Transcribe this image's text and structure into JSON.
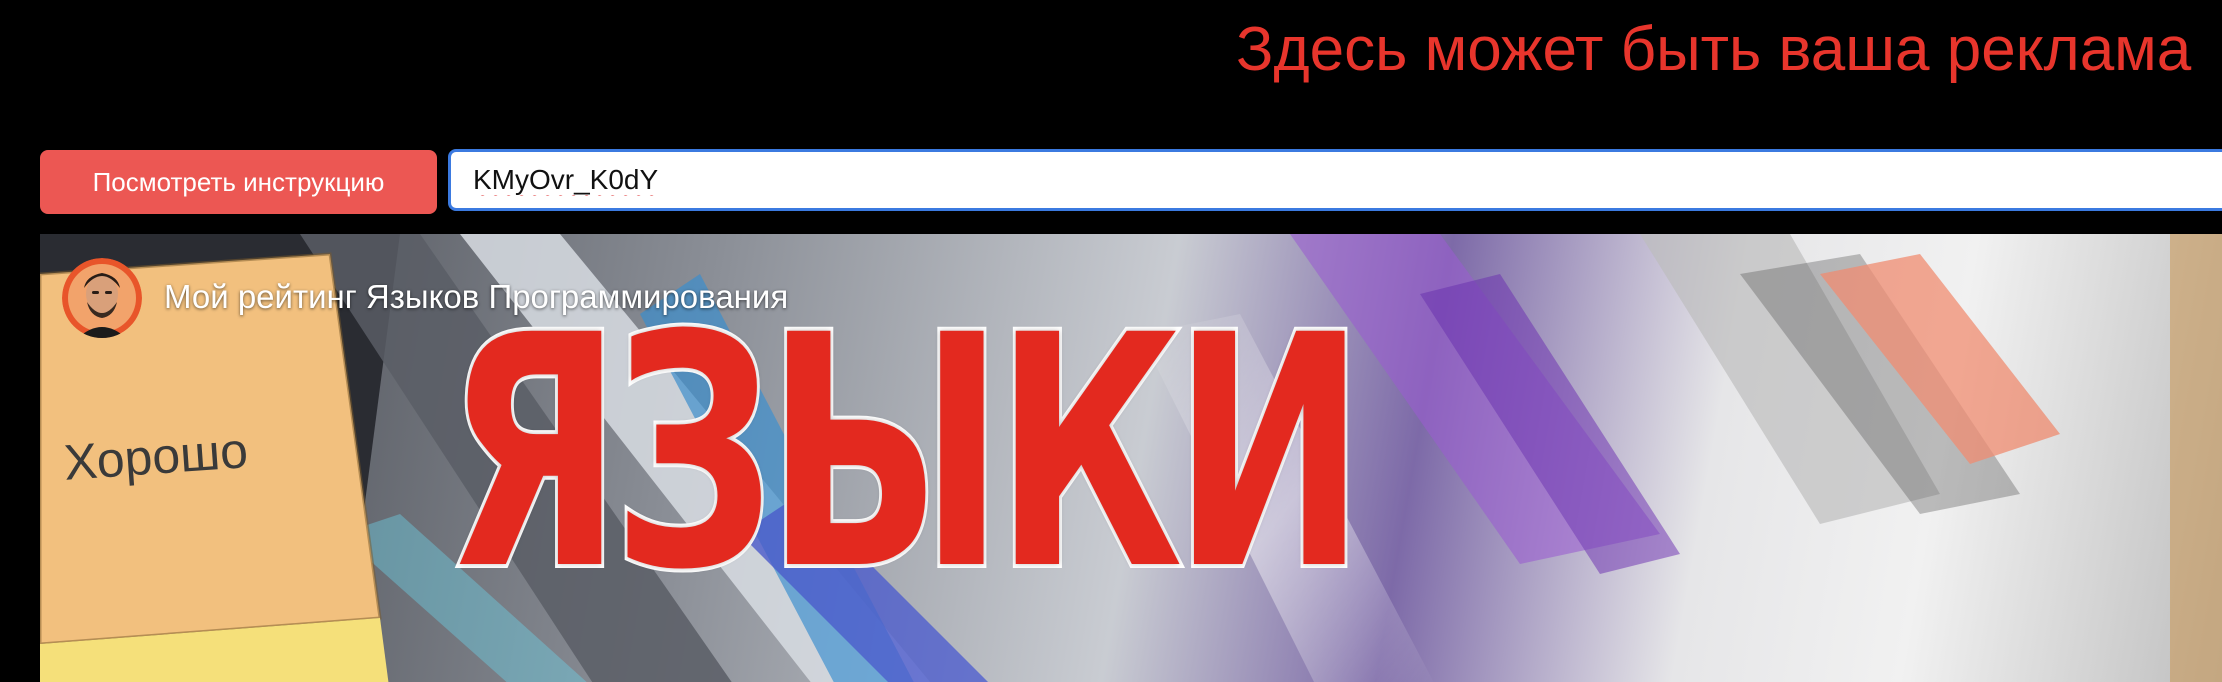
{
  "ad_banner": {
    "text": "Здесь может быть ваша реклама"
  },
  "toolbar": {
    "instructions_button_label": "Посмотреть инструкцию",
    "video_id_input_value": "KMyOvr_K0dY"
  },
  "player": {
    "video_title": "Мой рейтинг Языков Программирования",
    "thumbnail": {
      "tier_label": "Хорошо",
      "headline": "ЯЗЫКИ"
    }
  },
  "colors": {
    "ad_text": "#e8352c",
    "button_bg": "#ec5753",
    "input_focus_border": "#3b7ae0",
    "headline_red": "#e3291f",
    "tier_card": "#f2c07e"
  },
  "icons": {
    "channel_avatar": "channel-avatar"
  }
}
